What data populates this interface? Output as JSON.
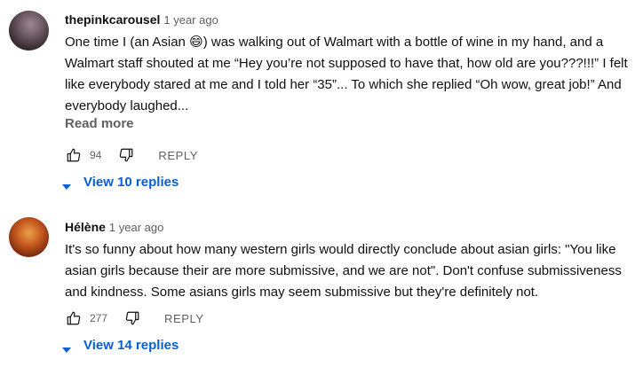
{
  "comments": [
    {
      "author": "thepinkcarousel",
      "time": "1 year ago",
      "text": "One time I (an Asian 😄) was walking out of Walmart with a bottle of wine in my hand, and a Walmart staff shouted at me “Hey you’re not supposed to have that, how old are you???!!!” I felt like everybody stared at me and I told her “35”... To which she replied “Oh wow, great job!” And everybody laughed...",
      "read_more": "Read more",
      "likes": "94",
      "reply_label": "REPLY",
      "view_replies": "View 10 replies"
    },
    {
      "author": "Hélène",
      "time": "1 year ago",
      "text": "It's so funny about how many western girls would directly conclude about asian girls: \"You like asian girls because their are more submissive, and we are not\". Don't confuse submissiveness and kindness. Some asians girls may seem submissive but they're definitely not.",
      "likes": "277",
      "reply_label": "REPLY",
      "view_replies": "View 14 replies"
    }
  ],
  "icons": {
    "like": "thumbs-up-icon",
    "dislike": "thumbs-down-icon",
    "expand": "caret-down-icon"
  },
  "colors": {
    "link": "#065fd4",
    "secondary": "#606060",
    "text": "#0f0f0f"
  }
}
